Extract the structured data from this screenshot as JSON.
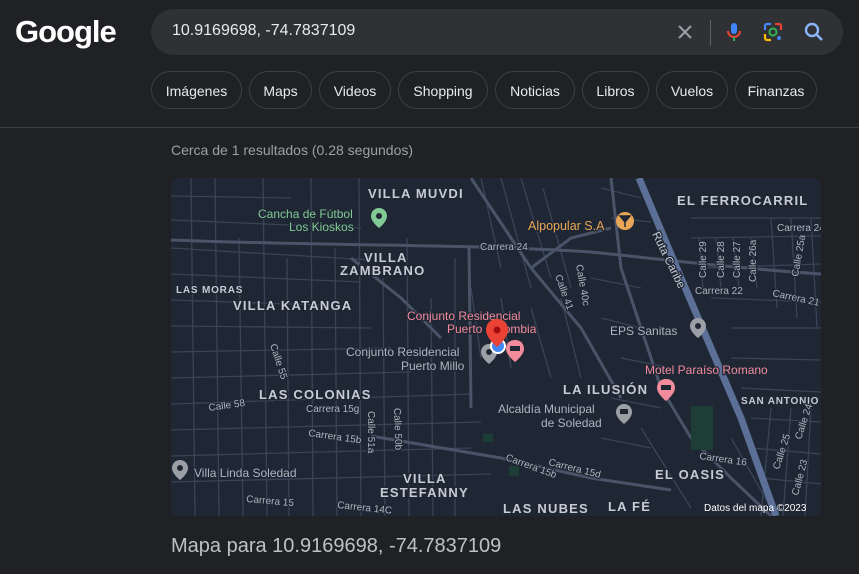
{
  "logo": "Google",
  "search": {
    "query": "10.9169698, -74.7837109"
  },
  "tabs": [
    "Imágenes",
    "Maps",
    "Videos",
    "Shopping",
    "Noticias",
    "Libros",
    "Vuelos",
    "Finanzas"
  ],
  "result_stats": "Cerca de 1 resultados (0.28 segundos)",
  "map": {
    "neighborhoods": {
      "villa_muvdi": "VILLA MUVDI",
      "villa_zambrano_1": "VILLA",
      "villa_zambrano_2": "ZAMBRANO",
      "las_moras": "LAS MORAS",
      "villa_katanga": "VILLA KATANGA",
      "las_colonias": "LAS COLONIAS",
      "la_ilusion": "LA ILUSIÓN",
      "el_ferrocarril": "EL FERROCARRIL",
      "san_antonio": "SAN ANTONIO",
      "el_oasis": "EL OASIS",
      "villa_estefanny_1": "VILLA",
      "villa_estefanny_2": "ESTEFANNY",
      "las_nubes": "LAS NUBES",
      "la_fe": "LA FÉ"
    },
    "streets": {
      "carrera_24_a": "Carrera 24",
      "carrera_24_b": "Carrera 24",
      "carrera_22": "Carrera 22",
      "carrera_21": "Carrera 21",
      "ruta_caribe": "Ruta Caribe",
      "calle_29": "Calle 29",
      "calle_28": "Calle 28",
      "calle_27": "Calle 27",
      "calle_26a": "Calle 26a",
      "calle_25a": "Calle 25a",
      "calle_41": "Calle 41",
      "calle_40c": "Calle 40c",
      "calle_55": "Calle 55",
      "calle_58": "Calle 58",
      "carrera_15g": "Carrera 15g",
      "carrera_15b": "Carrera 15b",
      "calle_51a": "Calle 51a",
      "calle_50b": "Calle 50b",
      "carrera_15d": "Carrera 15d",
      "carrera_15b_2": "Carrera 15b",
      "carrera_16": "Carrera 16",
      "carrera_15": "Carrera 15",
      "carrera_14c": "Carrera 14C",
      "calle_25": "Calle 25",
      "calle_24": "Calle 24",
      "calle_23": "Calle 23"
    },
    "places": {
      "cancha_1": "Cancha de Fútbol",
      "cancha_2": "Los Kioskos",
      "alpopular": "Alpopular S.A",
      "conjunto_colombia_1": "Conjunto Residencial",
      "conjunto_colombia_2": "Puerto Colombia",
      "conjunto_millo_1": "Conjunto Residencial",
      "conjunto_millo_2": "Puerto Millo",
      "eps": "EPS Sanitas",
      "motel": "Motel Paraíso Romano",
      "alcaldia_1": "Alcaldía Municipal",
      "alcaldia_2": "de Soledad",
      "villa_linda": "Villa Linda Soledad"
    },
    "attribution": "Datos del mapa ©2023"
  },
  "caption": "Mapa para 10.9169698, -74.7837109",
  "colors": {
    "accent_blue": "#8ab4f8",
    "pin_red": "#ea4335",
    "poi_pink": "#f28b9b",
    "poi_green": "#81c995",
    "poi_orange": "#e8a656"
  }
}
